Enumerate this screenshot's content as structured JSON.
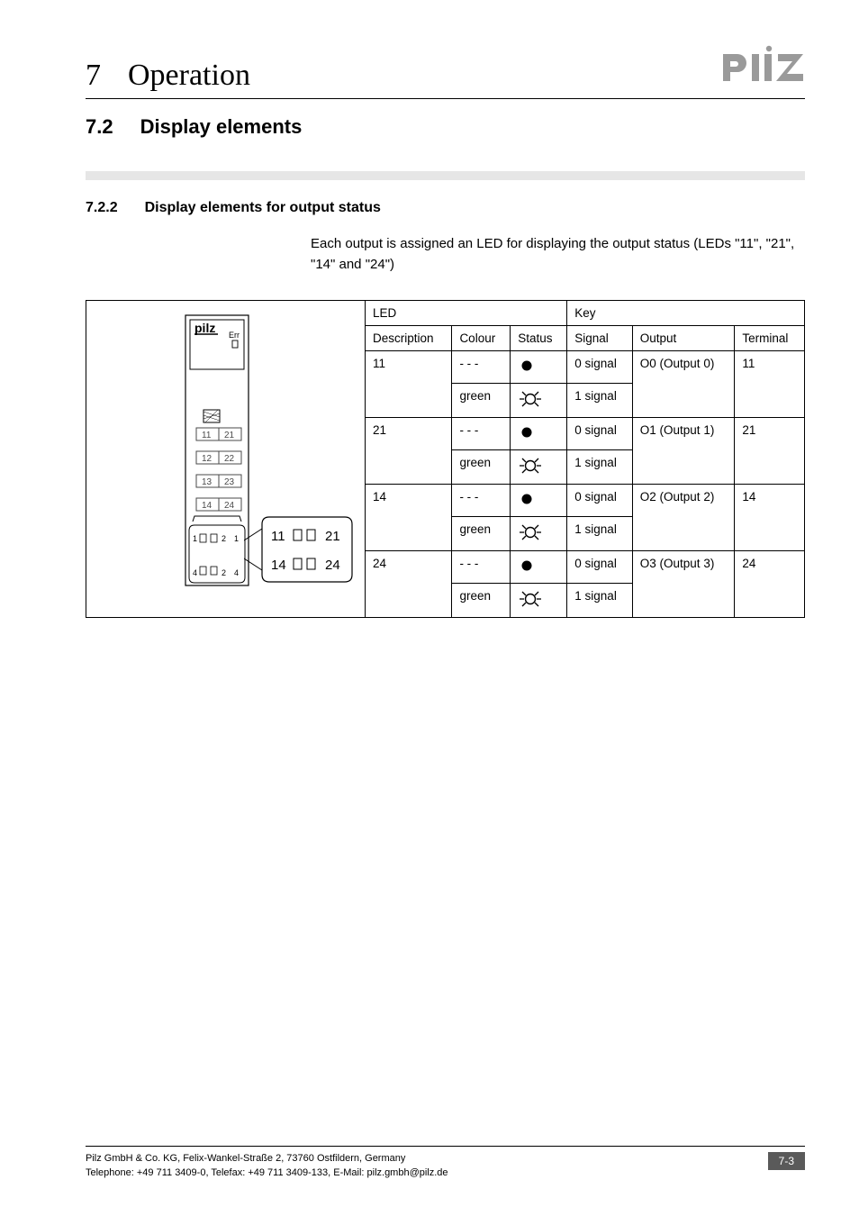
{
  "chapter": {
    "number": "7",
    "title": "Operation"
  },
  "section": {
    "number": "7.2",
    "title": "Display elements"
  },
  "subsection": {
    "number": "7.2.2",
    "title": "Display elements for output status"
  },
  "paragraph": "Each output is assigned an LED for displaying the output status (LEDs \"11\", \"21\", \"14\" and \"24\")",
  "table": {
    "group_headers": {
      "led": "LED",
      "key": "Key"
    },
    "headers": {
      "description": "Description",
      "colour": "Colour",
      "status": "Status",
      "signal": "Signal",
      "output": "Output",
      "terminal": "Terminal"
    },
    "rows": [
      {
        "description": "11",
        "output": "O0 (Output 0)",
        "terminal": "11",
        "states": [
          {
            "colour": "- - -",
            "status_icon": "off",
            "signal": "0 signal"
          },
          {
            "colour": "green",
            "status_icon": "on",
            "signal": "1 signal"
          }
        ]
      },
      {
        "description": "21",
        "output": "O1 (Output 1)",
        "terminal": "21",
        "states": [
          {
            "colour": "- - -",
            "status_icon": "off",
            "signal": "0 signal"
          },
          {
            "colour": "green",
            "status_icon": "on",
            "signal": "1 signal"
          }
        ]
      },
      {
        "description": "14",
        "output": "O2 (Output 2)",
        "terminal": "14",
        "states": [
          {
            "colour": "- - -",
            "status_icon": "off",
            "signal": "0 signal"
          },
          {
            "colour": "green",
            "status_icon": "on",
            "signal": "1 signal"
          }
        ]
      },
      {
        "description": "24",
        "output": "O3 (Output 3)",
        "terminal": "24",
        "states": [
          {
            "colour": "- - -",
            "status_icon": "off",
            "signal": "0 signal"
          },
          {
            "colour": "green",
            "status_icon": "on",
            "signal": "1 signal"
          }
        ]
      }
    ]
  },
  "figure": {
    "brand": "pilz",
    "err_label": "Err",
    "led_rows": [
      "11 21",
      "12 22",
      "13 23",
      "14 24"
    ],
    "terminal_left_top": "1",
    "terminal_left_top_right": "2",
    "terminal_left_bot": "4",
    "terminal_left_bot_right": "24",
    "callout_top": "11      21",
    "callout_bot": "14      24"
  },
  "footer": {
    "line1": "Pilz GmbH & Co. KG, Felix-Wankel-Straße 2, 73760 Ostfildern, Germany",
    "line2": "Telephone: +49 711 3409-0, Telefax: +49 711 3409-133, E-Mail: pilz.gmbh@pilz.de",
    "page": "7-3"
  }
}
